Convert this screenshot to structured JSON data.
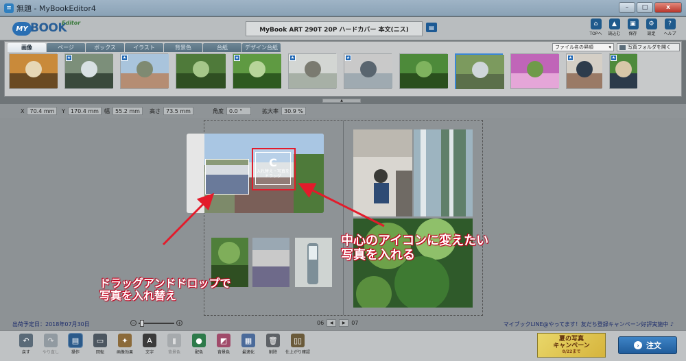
{
  "window": {
    "title": "無題 - MyBookEditor4",
    "min": "–",
    "max": "□",
    "close": "x"
  },
  "logo": {
    "my": "MY",
    "book": "BOOK",
    "editor": "Editor"
  },
  "product_name": "MyBook ART 290T 20P ハードカバー 本文(ニス)",
  "top_actions": [
    {
      "label": "TOPへ",
      "icon": "home-icon",
      "glyph": "⌂"
    },
    {
      "label": "読込む",
      "icon": "load-icon",
      "glyph": "▲"
    },
    {
      "label": "保存",
      "icon": "save-icon",
      "glyph": "▣"
    },
    {
      "label": "設定",
      "icon": "gear-icon",
      "glyph": "⚙"
    },
    {
      "label": "ヘルプ",
      "icon": "help-icon",
      "glyph": "?"
    }
  ],
  "tabs": [
    "画像",
    "ページ",
    "ボックス",
    "イラスト",
    "背景色",
    "台紙",
    "デザイン台紙"
  ],
  "sort_select": "ファイル名の昇順",
  "open_folder": "写真フォルダを開く",
  "thumbnails": [
    {
      "star": false,
      "selected": false,
      "colors": [
        "#c98a3a",
        "#e6d7b6",
        "#6a4a22"
      ]
    },
    {
      "star": true,
      "selected": false,
      "colors": [
        "#7c8f7a",
        "#d8e1e3",
        "#3a4a3c"
      ]
    },
    {
      "star": true,
      "selected": false,
      "colors": [
        "#a9c4dc",
        "#7f8a72",
        "#b58d73"
      ]
    },
    {
      "star": false,
      "selected": false,
      "colors": [
        "#4f7a3a",
        "#a6c78a",
        "#2f4f22"
      ]
    },
    {
      "star": true,
      "selected": false,
      "colors": [
        "#5f9a42",
        "#b7d59a",
        "#2e5a20"
      ]
    },
    {
      "star": true,
      "selected": false,
      "colors": [
        "#d3d6d3",
        "#7a7a70",
        "#a7b0a6"
      ]
    },
    {
      "star": true,
      "selected": false,
      "colors": [
        "#c9c9c9",
        "#59656f",
        "#9faab1"
      ]
    },
    {
      "star": false,
      "selected": false,
      "colors": [
        "#4d8a3a",
        "#7fb35e",
        "#2a4f1d"
      ]
    },
    {
      "star": false,
      "selected": true,
      "colors": [
        "#7c9a5e",
        "#cfd6d9",
        "#5b6f4a"
      ]
    },
    {
      "star": false,
      "selected": false,
      "colors": [
        "#c065b8",
        "#6f9a4a",
        "#e5a6d8"
      ]
    },
    {
      "star": true,
      "selected": false,
      "colors": [
        "#d5cfc6",
        "#2e3c4c",
        "#9a7a66"
      ]
    },
    {
      "star": true,
      "selected": false,
      "colors": [
        "#4e8a3c",
        "#d7c7a8",
        "#2b3a4a"
      ]
    }
  ],
  "props": [
    {
      "label": "X",
      "value": "70.4 mm"
    },
    {
      "label": "Y",
      "value": "170.4 mm"
    },
    {
      "label": "幅",
      "value": "55.2 mm"
    },
    {
      "label": "高さ",
      "value": "73.5 mm"
    },
    {
      "label": "角度",
      "value": "0.0 °"
    },
    {
      "label": "拡大率",
      "value": "30.9 %"
    }
  ],
  "swap_icon": {
    "glyph": "C",
    "text": "入れ替え・写真をドラッグ"
  },
  "annotations": {
    "center_icon": [
      "中心のアイコンに変えたい",
      "写真を入れる"
    ],
    "drag_drop": [
      "ドラッグアンドドロップで",
      "写真を入れ替え"
    ]
  },
  "status": {
    "ship_date": "出荷予定日：2018年07月30日",
    "page_left": "06",
    "page_right": "07",
    "prev": "◀",
    "next": "▶",
    "campaign": "マイブックLINE@やってます！友だち登録キャンペーン好評実施中 ♪",
    "zoom_out": "−",
    "zoom_in": "+"
  },
  "tools": [
    {
      "label": "戻す",
      "icon": "undo-icon",
      "glyph": "↶",
      "color": "#5a6a78",
      "active": false,
      "disabled": false
    },
    {
      "label": "やり直し",
      "icon": "redo-icon",
      "glyph": "↷",
      "color": "#5a6a78",
      "active": false,
      "disabled": true
    },
    {
      "label": "操作",
      "icon": "operate-icon",
      "glyph": "▤",
      "color": "#2b5a8a",
      "active": true,
      "disabled": false
    },
    {
      "label": "回転",
      "icon": "rotate-icon",
      "glyph": "▭",
      "color": "#4c5660",
      "active": false,
      "disabled": false
    },
    {
      "label": "画像効果",
      "icon": "image-effect-icon",
      "glyph": "✦",
      "color": "#8b6a3a",
      "active": false,
      "disabled": false
    },
    {
      "label": "文字",
      "icon": "text-icon",
      "glyph": "A",
      "color": "#3a3a3a",
      "active": false,
      "disabled": false
    },
    {
      "label": "背景色",
      "icon": "bgcolor-disabled-icon",
      "glyph": "▮",
      "color": "#8a8f92",
      "active": false,
      "disabled": true
    },
    {
      "label": "配色",
      "icon": "color-scheme-icon",
      "glyph": "●",
      "color": "#2d7a4a",
      "active": false,
      "disabled": false
    },
    {
      "label": "背景色",
      "icon": "background-color-icon",
      "glyph": "◩",
      "color": "#a04a6a",
      "active": false,
      "disabled": false
    },
    {
      "label": "最適化",
      "icon": "optimize-icon",
      "glyph": "▦",
      "color": "#4a6a9a",
      "active": false,
      "disabled": false
    },
    {
      "label": "削除",
      "icon": "trash-icon",
      "glyph": "🗑",
      "color": "#5d6166",
      "active": false,
      "disabled": false
    },
    {
      "label": "仕上がり確認",
      "icon": "preview-book-icon",
      "glyph": "▯▯",
      "color": "#6a5a3a",
      "active": false,
      "disabled": false
    }
  ],
  "banner": {
    "line1": "夏の写真",
    "line2": "キャンペーン",
    "date": "8/22まで"
  },
  "order_button": {
    "label": "注文",
    "glyph": "›"
  },
  "colors": {
    "accent": "#e31b2b",
    "primary": "#205c9b"
  }
}
